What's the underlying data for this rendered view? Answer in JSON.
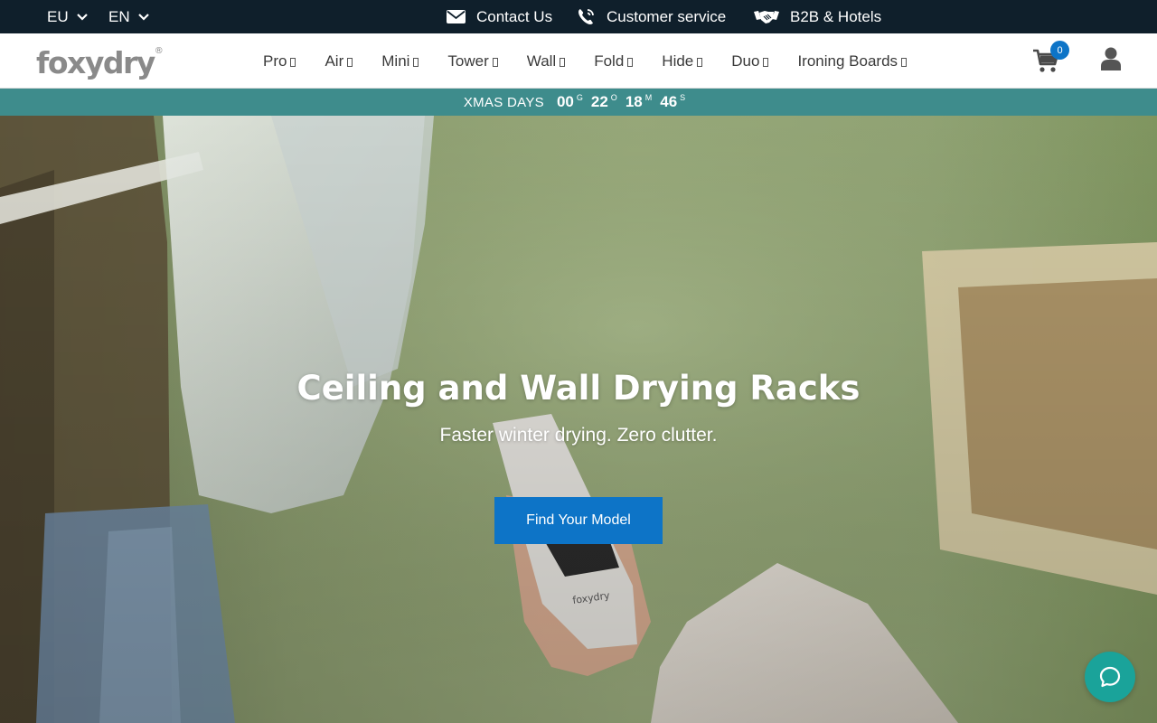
{
  "topbar": {
    "region": "EU",
    "language": "EN",
    "contact_label": "Contact Us",
    "service_label": "Customer service",
    "b2b_label": "B2B & Hotels"
  },
  "header": {
    "logo_text": "foxydry",
    "logo_mark": "®",
    "nav": [
      {
        "label": "Pro"
      },
      {
        "label": "Air"
      },
      {
        "label": "Mini"
      },
      {
        "label": "Tower"
      },
      {
        "label": "Wall"
      },
      {
        "label": "Fold"
      },
      {
        "label": "Hide"
      },
      {
        "label": "Duo"
      },
      {
        "label": "Ironing Boards"
      }
    ],
    "cart_count": "0"
  },
  "countdown": {
    "label": "XMAS DAYS",
    "days": "00",
    "days_unit": "G",
    "hours": "22",
    "hours_unit": "O",
    "minutes": "18",
    "minutes_unit": "M",
    "seconds": "46",
    "seconds_unit": "S"
  },
  "hero": {
    "title": "Ceiling and Wall Drying Racks",
    "subtitle": "Faster winter drying. Zero clutter.",
    "cta_label": "Find Your Model",
    "remote_brand": "foxydry"
  },
  "colors": {
    "topbar_bg": "#0f1f2b",
    "accent_blue": "#0d74c7",
    "countdown_bg": "#3e8c8c",
    "chat_teal": "#1aa39a"
  }
}
